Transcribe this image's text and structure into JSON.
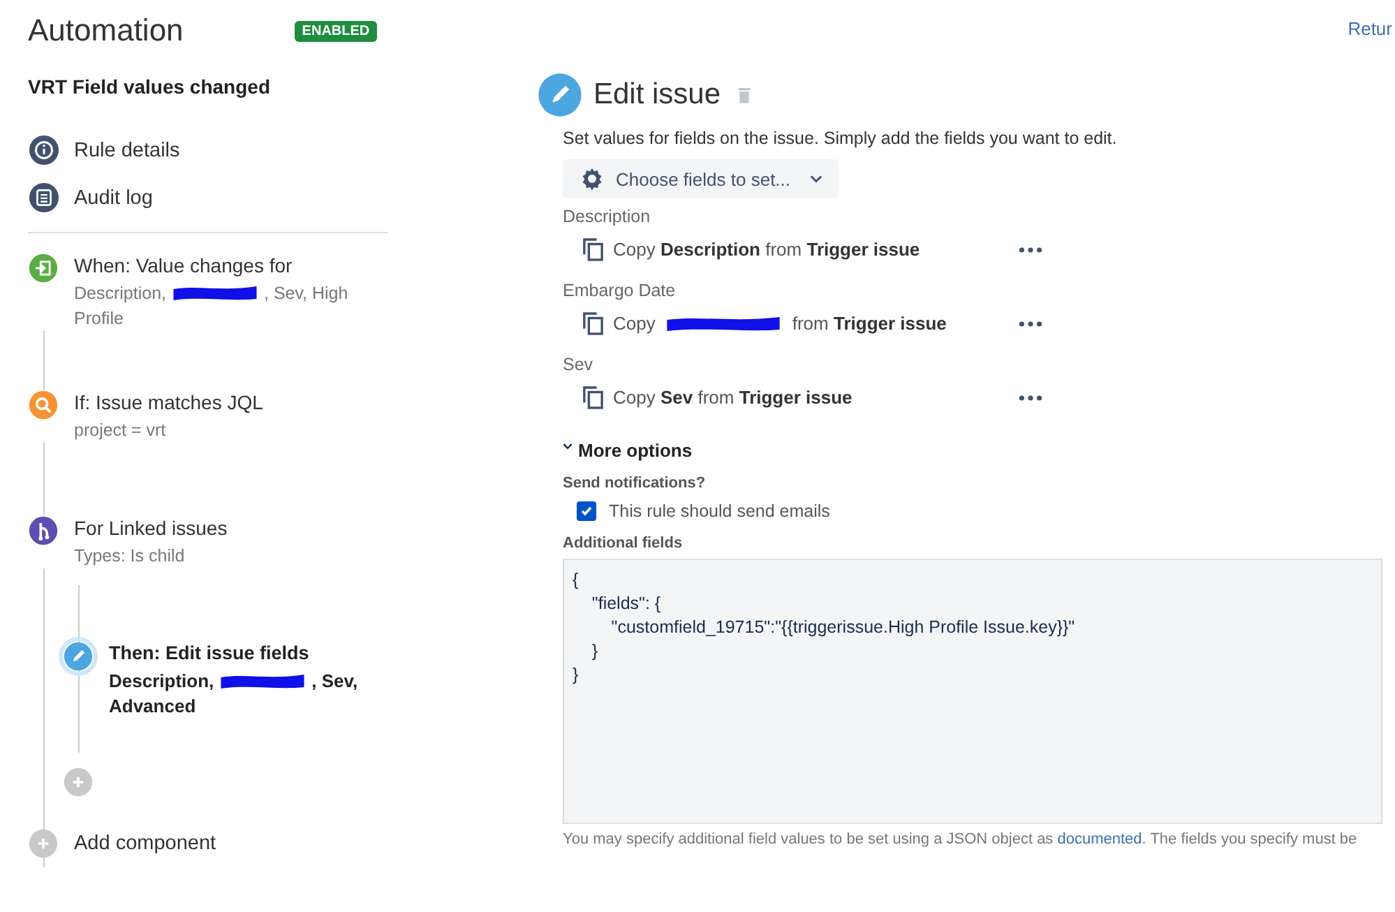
{
  "header": {
    "title": "Automation",
    "status_badge": "ENABLED",
    "return_link": "Retur"
  },
  "rule_name": "VRT Field values changed",
  "nav": [
    {
      "kind": "info",
      "label": "Rule details"
    },
    {
      "kind": "log",
      "label": "Audit log"
    }
  ],
  "steps": [
    {
      "kind": "trigger",
      "title": "When: Value changes for",
      "detail_before": "Description,",
      "redacted": true,
      "detail_after": [
        ", Sev, High",
        "Profile"
      ]
    },
    {
      "kind": "condition",
      "title": "If: Issue matches JQL",
      "detail_before": "project = vrt",
      "redacted": false
    },
    {
      "kind": "branch",
      "title": "For Linked issues",
      "detail_before": "Types: Is child",
      "redacted": false,
      "children": [
        {
          "kind": "action",
          "title": "Then: Edit issue fields",
          "detail_before": "Description,",
          "redacted": true,
          "detail_after": [
            ", Sev,",
            "Advanced"
          ],
          "selected": true
        }
      ]
    }
  ],
  "add_component": "Add component",
  "editor": {
    "title": "Edit issue",
    "description": "Set values for fields on the issue. Simply add the fields you want to edit.",
    "choose_button": "Choose fields to set...",
    "fields": [
      {
        "label": "Description",
        "before": "Copy **Description** from **Trigger issue**",
        "redacted": false
      },
      {
        "label": "Embargo Date",
        "before": "Copy",
        "redacted": true,
        "after": "from **Trigger issue**"
      },
      {
        "label": "Sev",
        "before": "Copy **Sev** from **Trigger issue**",
        "redacted": false
      }
    ],
    "more_options": {
      "label": "More options",
      "expanded": true
    },
    "notifications_label": "Send notifications?",
    "send_emails": {
      "label": "This rule should send emails",
      "checked": true
    },
    "additional_fields": {
      "label": "Additional fields",
      "value": "{\n    \"fields\": {\n        \"customfield_19715\":\"{{triggerissue.High Profile Issue.key}}\"\n    }\n}"
    },
    "help_before": "You may specify additional field values to be set using a JSON object as ",
    "help_link": "documented",
    "help_after": ". The fields you specify must be"
  }
}
